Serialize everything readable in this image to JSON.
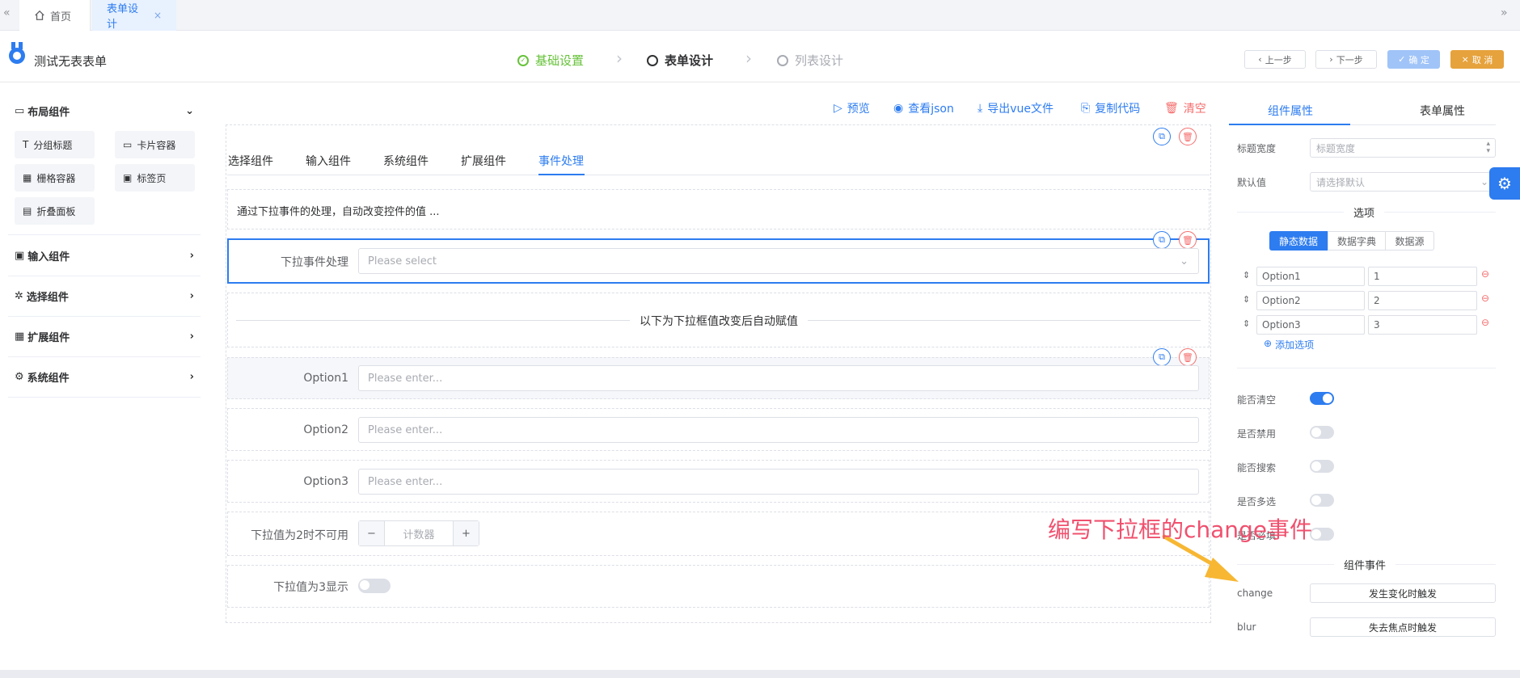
{
  "tabs": {
    "home": "首页",
    "active": "表单设计",
    "close": "×",
    "nav_left": "«",
    "nav_right": "»"
  },
  "header": {
    "title": "测试无表表单",
    "steps": [
      {
        "label": "基础设置",
        "state": "done"
      },
      {
        "label": "表单设计",
        "state": "current"
      },
      {
        "label": "列表设计",
        "state": "todo"
      }
    ],
    "buttons": {
      "prev": "上一步",
      "next": "下一步",
      "confirm": "确 定",
      "cancel": "取 消"
    }
  },
  "left": {
    "groups": [
      "布局组件",
      "输入组件",
      "选择组件",
      "扩展组件",
      "系统组件"
    ],
    "layout_items": [
      "分组标题",
      "卡片容器",
      "栅格容器",
      "标签页",
      "折叠面板"
    ]
  },
  "toolbar": {
    "preview": "预览",
    "json": "查看json",
    "export": "导出vue文件",
    "copy": "复制代码",
    "clear": "清空"
  },
  "canvas": {
    "tabs": [
      "选择组件",
      "输入组件",
      "系统组件",
      "扩展组件",
      "事件处理"
    ],
    "active_tab": "事件处理",
    "description": "通过下拉事件的处理，自动改变控件的值 ...",
    "select_label": "下拉事件处理",
    "select_placeholder": "Please select",
    "divider_text": "以下为下拉框值改变后自动赋值",
    "options": [
      {
        "label": "Option1",
        "placeholder": "Please enter..."
      },
      {
        "label": "Option2",
        "placeholder": "Please enter..."
      },
      {
        "label": "Option3",
        "placeholder": "Please enter..."
      }
    ],
    "counter_label": "下拉值为2时不可用",
    "counter_placeholder": "计数器",
    "counter_minus": "−",
    "counter_plus": "+",
    "switch_label": "下拉值为3显示"
  },
  "right": {
    "tabs": [
      "组件属性",
      "表单属性"
    ],
    "title_width_label": "标题宽度",
    "title_width_placeholder": "标题宽度",
    "default_label": "默认值",
    "default_placeholder": "请选择默认",
    "options_title": "选项",
    "source_tabs": [
      "静态数据",
      "数据字典",
      "数据源"
    ],
    "option_rows": [
      {
        "label": "Option1",
        "value": "1"
      },
      {
        "label": "Option2",
        "value": "2"
      },
      {
        "label": "Option3",
        "value": "3"
      }
    ],
    "add_option": "添加选项",
    "switches": [
      {
        "label": "能否清空",
        "on": true
      },
      {
        "label": "是否禁用",
        "on": false
      },
      {
        "label": "能否搜索",
        "on": false
      },
      {
        "label": "是否多选",
        "on": false
      },
      {
        "label": "是否必填",
        "on": false
      }
    ],
    "events_title": "组件事件",
    "events": [
      {
        "name": "change",
        "button": "发生变化时触发"
      },
      {
        "name": "blur",
        "button": "失去焦点时触发"
      }
    ]
  },
  "annotation": {
    "text": "编写下拉框的change事件",
    "color": "#f0506e",
    "arrow_color": "#f7b733"
  },
  "colors": {
    "primary": "#2d7cf0",
    "success": "#67c23a",
    "danger": "#f56c6c",
    "warning": "#e6a23c"
  }
}
